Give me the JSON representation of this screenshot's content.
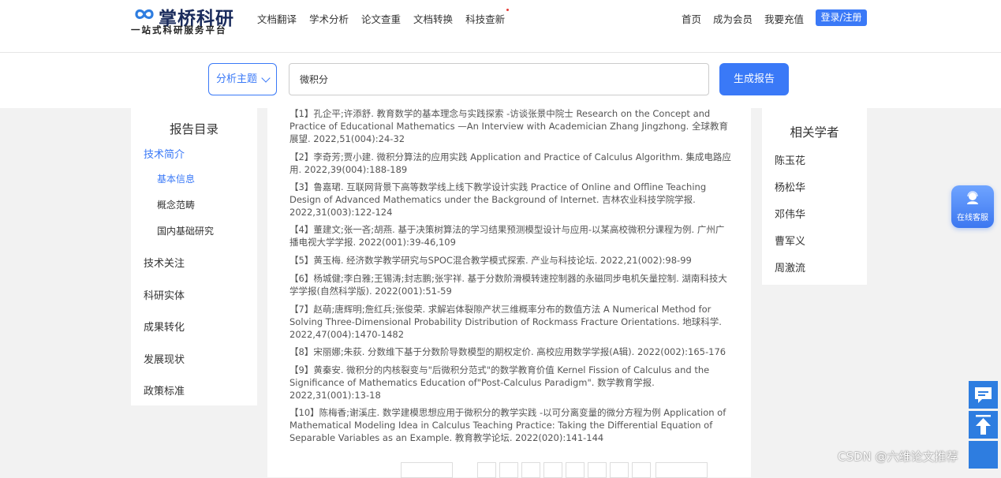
{
  "header": {
    "logo_name": "掌桥科研",
    "logo_slogan": "一站式科研服务平台",
    "nav": [
      "文档翻译",
      "学术分析",
      "论文查重",
      "文档转换",
      "科技查新"
    ],
    "right_nav": [
      "首页",
      "成为会员",
      "我要充值"
    ],
    "login_label": "登录/注册",
    "brand_color": "#3a79f7"
  },
  "search": {
    "topic_label": "分析主题",
    "query": "微积分",
    "generate_label": "生成报告"
  },
  "sidebar": {
    "title": "报告目录",
    "items": [
      {
        "label": "技术简介",
        "active": true
      },
      {
        "label": "基本信息",
        "sub": true,
        "active": true
      },
      {
        "label": "概念范畴",
        "sub": true
      },
      {
        "label": "国内基础研究",
        "sub": true
      },
      {
        "label": "技术关注"
      },
      {
        "label": "科研实体"
      },
      {
        "label": "成果转化"
      },
      {
        "label": "发展现状"
      },
      {
        "label": "政策标准"
      }
    ]
  },
  "references": [
    "【1】孔企平;许添舒. 教育数学的基本理念与实践探索 -访谈张景中院士 Research on the Concept and Practice of Educational Mathematics —An Interview with Academician Zhang Jingzhong. 全球教育展望. 2022,51(004):24-32",
    "【2】李奇芳;贾小建. 微积分算法的应用实践 Application and Practice of Calculus Algorithm. 集成电路应用. 2022,39(004):188-189",
    "【3】鲁嘉珺. 互联网背景下高等数学线上线下教学设计实践 Practice of Online and Offline Teaching Design of Advanced Mathematics under the Background of Internet. 吉林农业科技学院学报. 2022,31(003):122-124",
    "【4】董建文;张一吝;胡燕. 基于决策树算法的学习结果预测模型设计与应用-以某高校微积分课程为例. 广州广播电视大学学报. 2022(001):39-46,109",
    "【5】黄玉梅. 经济数学教学研究与SPOC混合教学模式探索. 产业与科技论坛. 2022,21(002):98-99",
    "【6】杨城健;李白雅;王锡涛;封志鹏;张宇祥. 基于分数阶滑模转速控制器的永磁同步电机矢量控制. 湖南科技大学学报(自然科学版). 2022(001):51-59",
    "【7】赵萌;唐辉明;詹红兵;张俊荣. 求解岩体裂隙产状三维概率分布的数值方法 A Numerical Method for Solving Three-Dimensional Probability Distribution of Rockmass Fracture Orientations. 地球科学. 2022,47(004):1470-1482",
    "【8】宋丽娜;朱荻. 分数维下基于分数阶导数模型的期权定价. 高校应用数学学报(A辑). 2022(002):165-176",
    "【9】黄秦安. 微积分的内核裂变与\"后微积分范式\"的数学教育价值 Kernel Fission of Calculus and the Significance of Mathematics Education of\"Post-Calculus Paradigm\". 数学教育学报. 2022,31(001):13-18",
    "【10】陈梅香;谢溪庄. 数学建模思想应用于微积分的教学实践 -以可分离变量的微分方程为例 Application of Mathematical Modeling Idea in Calculus Teaching Practice: Taking the Differential Equation of Separable Variables as an Example. 教育教学论坛. 2022(020):141-144"
  ],
  "related": {
    "title": "相关学者",
    "scholars": [
      "陈玉花",
      "杨松华",
      "邓伟华",
      "曹军义",
      "周激流"
    ]
  },
  "widgets": {
    "online_service_label": "在线客服",
    "feedback_icon": "chat-bubble-icon",
    "top_icon": "arrow-up-icon"
  },
  "watermark": "CSDN @六维论文推荐"
}
